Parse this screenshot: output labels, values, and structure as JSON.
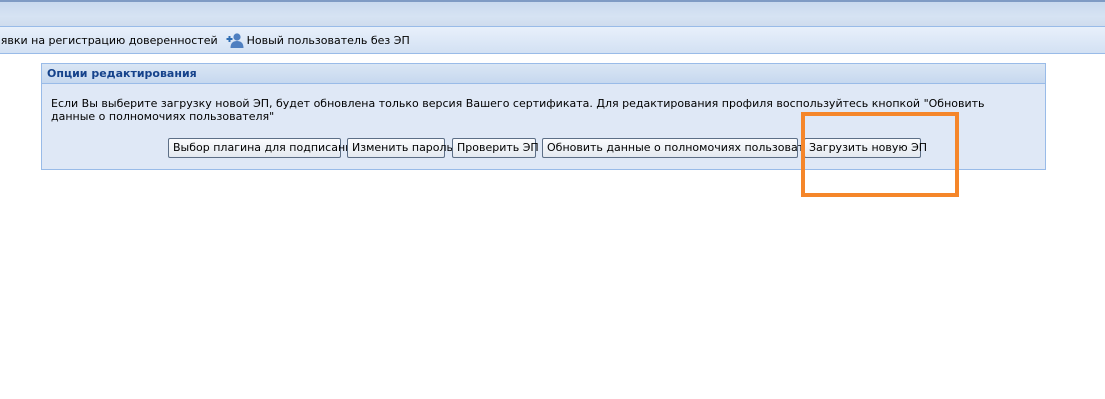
{
  "toolbar": {
    "items": [
      {
        "label": "аявки на регистрацию доверенностей",
        "icon": null
      },
      {
        "label": "Новый пользователь без ЭП",
        "icon": "add-user-icon"
      }
    ]
  },
  "panel": {
    "title": "Опции редактирования",
    "text": "Если Вы выберите загрузку новой ЭП, будет обновлена только версия Вашего сертификата. Для редактирования профиля воспользуйтесь кнопкой \"Обновить данные о полномочиях пользователя\"",
    "buttons": [
      {
        "label": "Выбор плагина для подписания"
      },
      {
        "label": "Изменить пароль"
      },
      {
        "label": "Проверить ЭП"
      },
      {
        "label": "Обновить данные о полномочиях пользователя"
      },
      {
        "label": "Загрузить новую ЭП"
      }
    ]
  },
  "colors": {
    "panel_title": "#15428b",
    "highlight": "#f5862a",
    "border": "#99bbe8"
  }
}
